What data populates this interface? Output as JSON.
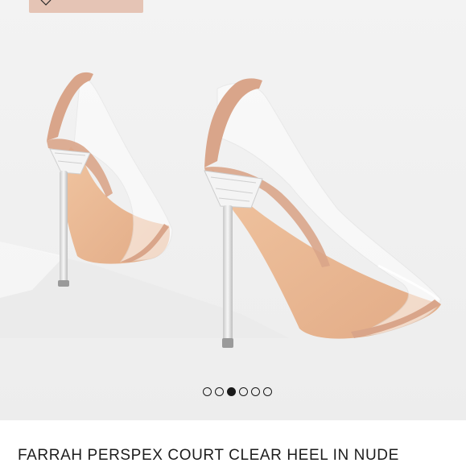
{
  "product": {
    "title": "FARRAH PERSPEX COURT CLEAR HEEL IN NUDE"
  },
  "gallery": {
    "image_count": 6,
    "active_index": 2,
    "image_subject": "clear perspex court heels with nude trim"
  },
  "wishlist": {
    "icon": "heart-icon"
  },
  "colors": {
    "trim": "#d9a58a",
    "sole": "#e7b692",
    "background": "#f2f2f2",
    "chip": "#e5c4b5"
  }
}
